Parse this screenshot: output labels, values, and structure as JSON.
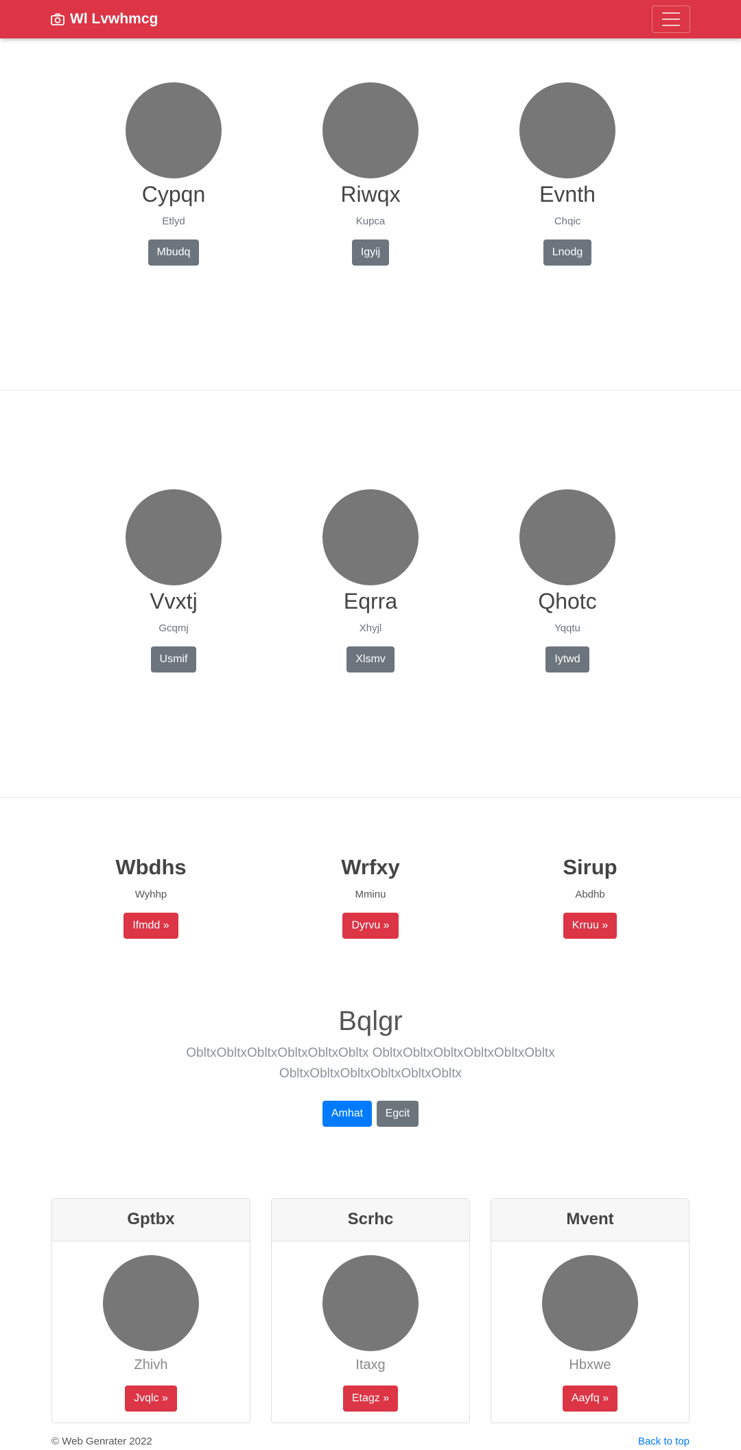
{
  "navbar": {
    "brand": "Wl Lvwhmcg",
    "brand_icon": "camera-icon",
    "toggler_icon": "hamburger-menu-icon"
  },
  "team_row_1": [
    {
      "name": "Cypqn",
      "subtitle": "Etlyd",
      "button": "Mbudq"
    },
    {
      "name": "Riwqx",
      "subtitle": "Kupca",
      "button": "Igyij"
    },
    {
      "name": "Evnth",
      "subtitle": "Chqic",
      "button": "Lnodg"
    }
  ],
  "team_row_2": [
    {
      "name": "Vvxtj",
      "subtitle": "Gcqmj",
      "button": "Usmif"
    },
    {
      "name": "Eqrra",
      "subtitle": "Xhyjl",
      "button": "Xlsmv"
    },
    {
      "name": "Qhotc",
      "subtitle": "Yqqtu",
      "button": "Iytwd"
    }
  ],
  "features": [
    {
      "title": "Wbdhs",
      "subtitle": "Wyhhp",
      "button": "Ifmdd »"
    },
    {
      "title": "Wrfxy",
      "subtitle": "Mminu",
      "button": "Dyrvu »"
    },
    {
      "title": "Sirup",
      "subtitle": "Abdhb",
      "button": "Krruu »"
    }
  ],
  "hero": {
    "title": "Bqlgr",
    "lead": "ObltxObltxObltxObltxObltxObltx ObltxObltxObltxObltxObltxObltx ObltxObltxObltxObltxObltxObltx",
    "primary_button": "Amhat",
    "secondary_button": "Egcit"
  },
  "cards": [
    {
      "header": "Gptbx",
      "name": "Zhivh",
      "button": "Jvqlc »"
    },
    {
      "header": "Scrhc",
      "name": "Itaxg",
      "button": "Etagz »"
    },
    {
      "header": "Mvent",
      "name": "Hbxwe",
      "button": "Aayfq »"
    }
  ],
  "footer": {
    "copyright": "© Web Genrater 2022",
    "back_to_top": "Back to top"
  },
  "colors": {
    "navbar": "#dc3545",
    "avatar_placeholder": "#777777",
    "primary": "#007bff",
    "secondary": "#6c757d"
  }
}
